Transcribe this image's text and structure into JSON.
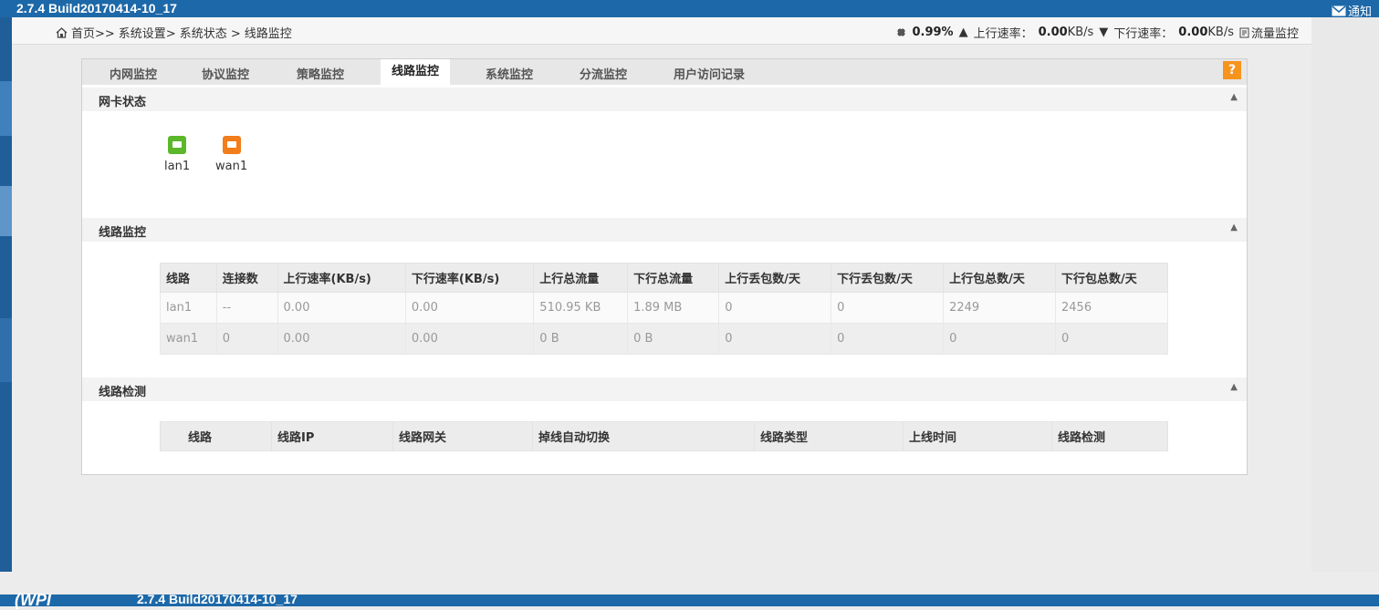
{
  "app": {
    "build": "2.7.4 Build20170414-10_17",
    "notify_label": "通知"
  },
  "breadcrumb": {
    "home": "首页>>",
    "level2": "系统设置>",
    "level3": "系统状态 >",
    "current": "线路监控"
  },
  "status": {
    "cpu_value": "0.99%",
    "up_label": "上行速率：",
    "up_value": "0.00",
    "up_unit": "KB/s",
    "down_label": "下行速率：",
    "down_value": "0.00",
    "down_unit": "KB/s",
    "traffic_label": "流量监控"
  },
  "tabs": [
    "内网监控",
    "协议监控",
    "策略监控",
    "线路监控",
    "系统监控",
    "分流监控",
    "用户访问记录"
  ],
  "active_tab": "线路监控",
  "help_label": "?",
  "nic_section": {
    "title": "网卡状态",
    "interfaces": [
      {
        "name": "lan1",
        "color": "#5cb82a"
      },
      {
        "name": "wan1",
        "color": "#f27d1a"
      }
    ]
  },
  "line_monitor": {
    "title": "线路监控",
    "headers": [
      "线路",
      "连接数",
      "上行速率(KB/s)",
      "下行速率(KB/s)",
      "上行总流量",
      "下行总流量",
      "上行丢包数/天",
      "下行丢包数/天",
      "上行包总数/天",
      "下行包总数/天"
    ],
    "rows": [
      [
        "lan1",
        "--",
        "0.00",
        "0.00",
        "510.95 KB",
        "1.89 MB",
        "0",
        "0",
        "2249",
        "2456"
      ],
      [
        "wan1",
        "0",
        "0.00",
        "0.00",
        "0 B",
        "0 B",
        "0",
        "0",
        "0",
        "0"
      ]
    ]
  },
  "line_check": {
    "title": "线路检测",
    "headers": [
      "线路",
      "线路IP",
      "线路网关",
      "掉线自动切换",
      "线路类型",
      "上线时间",
      "线路检测"
    ]
  },
  "footer": {
    "logo": "(WPI",
    "build": "2.7.4 Build20170414-10_17"
  },
  "colors": {
    "brand_blue": "#1d68a8",
    "accent_orange": "#f7941e"
  }
}
